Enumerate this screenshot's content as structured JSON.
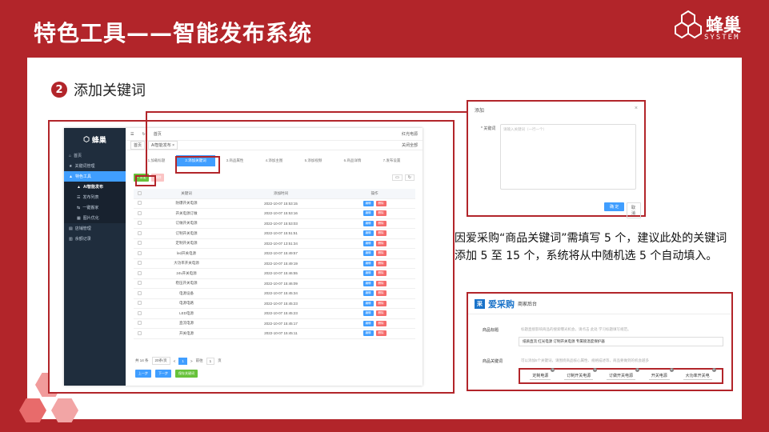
{
  "header": {
    "title": "特色工具——智能发布系统",
    "logo_text": "蜂巢",
    "logo_sub": "SYSTEM"
  },
  "step": {
    "num": "2",
    "title": "添加关键词"
  },
  "app": {
    "logo": "蜂巢",
    "sidebar": [
      {
        "label": "首页"
      },
      {
        "label": "关键词管理"
      },
      {
        "label": "特色工具"
      },
      {
        "label": "AI智能发布"
      },
      {
        "label": "发布列表"
      },
      {
        "label": "一键搬家"
      },
      {
        "label": "图片优化"
      },
      {
        "label": "店铺管理"
      },
      {
        "label": "余额记录"
      }
    ],
    "topbar": {
      "home": "首页",
      "user": "红光电源"
    },
    "tags": [
      "首页",
      "AI智能发布 ×"
    ],
    "tag_right": "关闭全部",
    "steps": [
      "1.加载标题",
      "2.添加关键词",
      "3.商品属性",
      "4.添加主图",
      "5.添加视频",
      "6.商品详情",
      "7.发布设置"
    ],
    "add_btn": "+ 添加",
    "del_btn": "删除",
    "table": {
      "headers": [
        "关键词",
        "添加时间",
        "操作"
      ],
      "edit": "编辑",
      "delete": "删除",
      "rows": [
        {
          "kw": "防爆开关电源",
          "time": "2022-10-07 15:53:15"
        },
        {
          "kw": "开关电源订做",
          "time": "2022-10-07 15:53:16"
        },
        {
          "kw": "订做开关电源",
          "time": "2022-10-07 15:53:03"
        },
        {
          "kw": "订制开关电源",
          "time": "2022-10-07 15:51:51"
        },
        {
          "kw": "定制开关电源",
          "time": "2022-10-07 13:51:34"
        },
        {
          "kw": "led开关电源",
          "time": "2022-10-07 15:49:57"
        },
        {
          "kw": "大功率开关电源",
          "time": "2022-10-07 15:49:19"
        },
        {
          "kw": "24v开关电源",
          "time": "2022-10-07 15:46:55"
        },
        {
          "kw": "稳压开关电源",
          "time": "2022-10-07 15:46:09"
        },
        {
          "kw": "电源设备",
          "time": "2022-10-07 15:45:34"
        },
        {
          "kw": "电源电路",
          "time": "2022-10-07 15:45:23"
        },
        {
          "kw": "LED电源",
          "time": "2022-10-07 15:45:23"
        },
        {
          "kw": "直流电源",
          "time": "2022-10-07 15:45:17"
        },
        {
          "kw": "开关电源",
          "time": "2022-10-07 15:45:11"
        }
      ]
    },
    "pager": {
      "total": "共 14 条",
      "size": "20条/页",
      "prev": "<",
      "p1": "1",
      "next": ">",
      "goto": "前往",
      "page": "1",
      "unit": "页"
    },
    "buttons": {
      "prev": "上一步",
      "next": "下一步",
      "save": "保存关键词"
    }
  },
  "dialog": {
    "title": "添加",
    "close": "×",
    "label": "* 关键词",
    "placeholder": "请输入关键词（一行一个）",
    "ok": "确 定",
    "cancel": "取 消"
  },
  "description": "因爱采购“商品关键词”需填写 5 个，建议此处的关键词添加 5 至 15 个，系统将从中随机选 5 个自动填入。",
  "store": {
    "logo": "爱采购",
    "name": "爱采购",
    "sub": "商家后台",
    "title_label": "商品标题",
    "title_tip": "标题直接影响商品的搜索曝光机会，请点击 此处 学习标题填写规范。",
    "title_value": "纸质直流 红光电源 订制开关电源 专属锁温度保护器",
    "kw_label": "商品关键词",
    "kw_tip": "可以添加5个关键词，请围绕商品核心属性、规格描述等，商品要做到的机会越多",
    "keywords": [
      "定制电源",
      "订制开关电源",
      "订做开关电源",
      "开关电源",
      "大功率开关电"
    ]
  }
}
